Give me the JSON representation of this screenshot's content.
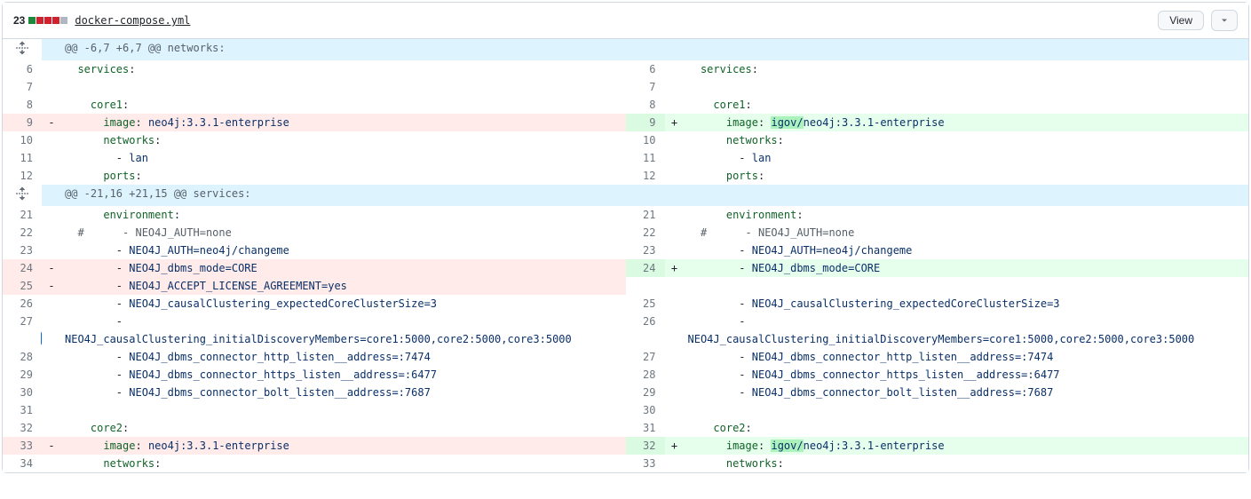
{
  "header": {
    "change_count": "23",
    "filename": "docker-compose.yml",
    "view_button": "View"
  },
  "hunks": [
    {
      "header": "@@ -6,7 +6,7 @@ networks:",
      "rows": [
        {
          "type": "ctx",
          "ln": "6",
          "rn": "6",
          "lc": "  services:",
          "rc": "  services:"
        },
        {
          "type": "ctx",
          "ln": "7",
          "rn": "7",
          "lc": "",
          "rc": ""
        },
        {
          "type": "ctx",
          "ln": "8",
          "rn": "8",
          "lc": "    core1:",
          "rc": "    core1:"
        },
        {
          "type": "chg",
          "ln": "9",
          "rn": "9",
          "lc": "      image: neo4j:3.3.1-enterprise",
          "rc": "      image: <HL>igov/</HL>neo4j:3.3.1-enterprise"
        },
        {
          "type": "ctx",
          "ln": "10",
          "rn": "10",
          "lc": "      networks:",
          "rc": "      networks:"
        },
        {
          "type": "ctx",
          "ln": "11",
          "rn": "11",
          "lc": "        - lan",
          "rc": "        - lan"
        },
        {
          "type": "ctx",
          "ln": "12",
          "rn": "12",
          "lc": "      ports:",
          "rc": "      ports:"
        }
      ]
    },
    {
      "header": "@@ -21,16 +21,15 @@ services:",
      "rows": [
        {
          "type": "ctx",
          "ln": "21",
          "rn": "21",
          "lc": "      environment:",
          "rc": "      environment:"
        },
        {
          "type": "ctx",
          "ln": "22",
          "rn": "22",
          "lc": "  #      - NEO4J_AUTH=none",
          "rc": "  #      - NEO4J_AUTH=none"
        },
        {
          "type": "ctx",
          "ln": "23",
          "rn": "23",
          "lc": "        - NEO4J_AUTH=neo4j/changeme",
          "rc": "        - NEO4J_AUTH=neo4j/changeme"
        },
        {
          "type": "chg",
          "ln": "24",
          "rn": "24",
          "lc": "        - NEO4J_dbms_mode=CORE",
          "rc": "        - NEO4J_dbms_mode=CORE"
        },
        {
          "type": "del",
          "ln": "25",
          "rn": "",
          "lc": "        - NEO4J_ACCEPT_LICENSE_AGREEMENT=yes",
          "rc": ""
        },
        {
          "type": "ctx",
          "ln": "26",
          "rn": "25",
          "lc": "        - NEO4J_causalClustering_expectedCoreClusterSize=3",
          "rc": "        - NEO4J_causalClustering_expectedCoreClusterSize=3"
        },
        {
          "type": "ctx",
          "ln": "27",
          "rn": "26",
          "lc": "        - NEO4J_causalClustering_initialDiscoveryMembers=core1:5000,core2:5000,core3:5000",
          "rc": "        - NEO4J_causalClustering_initialDiscoveryMembers=core1:5000,core2:5000,core3:5000",
          "hascomment": true,
          "wrap": true
        },
        {
          "type": "ctx",
          "ln": "28",
          "rn": "27",
          "lc": "        - NEO4J_dbms_connector_http_listen__address=:7474",
          "rc": "        - NEO4J_dbms_connector_http_listen__address=:7474"
        },
        {
          "type": "ctx",
          "ln": "29",
          "rn": "28",
          "lc": "        - NEO4J_dbms_connector_https_listen__address=:6477",
          "rc": "        - NEO4J_dbms_connector_https_listen__address=:6477"
        },
        {
          "type": "ctx",
          "ln": "30",
          "rn": "29",
          "lc": "        - NEO4J_dbms_connector_bolt_listen__address=:7687",
          "rc": "        - NEO4J_dbms_connector_bolt_listen__address=:7687"
        },
        {
          "type": "ctx",
          "ln": "31",
          "rn": "30",
          "lc": "",
          "rc": ""
        },
        {
          "type": "ctx",
          "ln": "32",
          "rn": "31",
          "lc": "    core2:",
          "rc": "    core2:"
        },
        {
          "type": "chg",
          "ln": "33",
          "rn": "32",
          "lc": "      image: neo4j:3.3.1-enterprise",
          "rc": "      image: <HL>igov/</HL>neo4j:3.3.1-enterprise"
        },
        {
          "type": "ctx",
          "ln": "34",
          "rn": "33",
          "lc": "      networks:",
          "rc": "      networks:"
        }
      ]
    }
  ]
}
